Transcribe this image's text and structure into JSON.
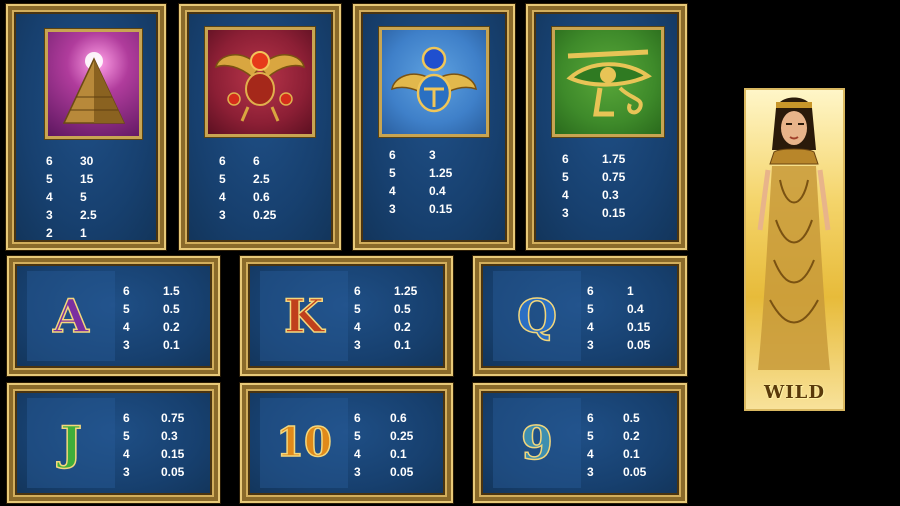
{
  "premium_symbols": [
    {
      "name": "pyramid",
      "payouts": [
        {
          "count": "6",
          "value": "30"
        },
        {
          "count": "5",
          "value": "15"
        },
        {
          "count": "4",
          "value": "5"
        },
        {
          "count": "3",
          "value": "2.5"
        },
        {
          "count": "2",
          "value": "1"
        }
      ]
    },
    {
      "name": "red-scarab",
      "payouts": [
        {
          "count": "6",
          "value": "6"
        },
        {
          "count": "5",
          "value": "2.5"
        },
        {
          "count": "4",
          "value": "0.6"
        },
        {
          "count": "3",
          "value": "0.25"
        }
      ]
    },
    {
      "name": "blue-scarab",
      "payouts": [
        {
          "count": "6",
          "value": "3"
        },
        {
          "count": "5",
          "value": "1.25"
        },
        {
          "count": "4",
          "value": "0.4"
        },
        {
          "count": "3",
          "value": "0.15"
        }
      ]
    },
    {
      "name": "eye-of-horus",
      "payouts": [
        {
          "count": "6",
          "value": "1.75"
        },
        {
          "count": "5",
          "value": "0.75"
        },
        {
          "count": "4",
          "value": "0.3"
        },
        {
          "count": "3",
          "value": "0.15"
        }
      ]
    }
  ],
  "card_symbols": [
    {
      "glyph": "A",
      "color": "#7b2fa0",
      "payouts": [
        {
          "count": "6",
          "value": "1.5"
        },
        {
          "count": "5",
          "value": "0.5"
        },
        {
          "count": "4",
          "value": "0.2"
        },
        {
          "count": "3",
          "value": "0.1"
        }
      ]
    },
    {
      "glyph": "K",
      "color": "#c0401c",
      "payouts": [
        {
          "count": "6",
          "value": "1.25"
        },
        {
          "count": "5",
          "value": "0.5"
        },
        {
          "count": "4",
          "value": "0.2"
        },
        {
          "count": "3",
          "value": "0.1"
        }
      ]
    },
    {
      "glyph": "Q",
      "color": "#2a6fc4",
      "payouts": [
        {
          "count": "6",
          "value": "1"
        },
        {
          "count": "5",
          "value": "0.4"
        },
        {
          "count": "4",
          "value": "0.15"
        },
        {
          "count": "3",
          "value": "0.05"
        }
      ]
    },
    {
      "glyph": "J",
      "color": "#3fae3a",
      "payouts": [
        {
          "count": "6",
          "value": "0.75"
        },
        {
          "count": "5",
          "value": "0.3"
        },
        {
          "count": "4",
          "value": "0.15"
        },
        {
          "count": "3",
          "value": "0.05"
        }
      ]
    },
    {
      "glyph": "10",
      "color": "#e08a1a",
      "payouts": [
        {
          "count": "6",
          "value": "0.6"
        },
        {
          "count": "5",
          "value": "0.25"
        },
        {
          "count": "4",
          "value": "0.1"
        },
        {
          "count": "3",
          "value": "0.05"
        }
      ]
    },
    {
      "glyph": "9",
      "color": "#3d8fb0",
      "payouts": [
        {
          "count": "6",
          "value": "0.5"
        },
        {
          "count": "5",
          "value": "0.2"
        },
        {
          "count": "4",
          "value": "0.1"
        },
        {
          "count": "3",
          "value": "0.05"
        }
      ]
    }
  ],
  "wild": {
    "label": "WILD"
  }
}
